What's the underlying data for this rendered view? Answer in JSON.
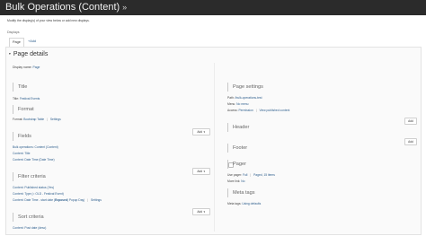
{
  "header": {
    "title": "Bulk Operations (Content)",
    "star": "»"
  },
  "description": "Modify the display(s) of your view below or add new displays.",
  "displays_label": "Displays",
  "tabs": [
    {
      "label": "Page"
    },
    {
      "label": "+Add"
    }
  ],
  "page_details": {
    "heading": "Page details",
    "caret": "▾",
    "display_name_label": "Display name:",
    "display_name_value": "Page"
  },
  "left": {
    "title": {
      "heading": "Title",
      "line_label": "Title:",
      "line_value": "Festival Events"
    },
    "format": {
      "heading": "Format",
      "label": "Format:",
      "value": "Bootstrap Table",
      "sep": "|",
      "settings": "Settings"
    },
    "fields": {
      "heading": "Fields",
      "add": "Add",
      "items": [
        "Bulk operations: Content (Content)",
        "Content: Title",
        "Content: Date Time (Date Time)"
      ]
    },
    "filter": {
      "heading": "Filter criteria",
      "add": "Add",
      "items": [
        "Content: Published status (Yes)",
        "Content: Type (= OLD - Festival Event)"
      ],
      "exposed_prefix": "Content: Date Time - start date (",
      "exposed_tag": "Exposed",
      "exposed_suffix": ") Popup Day)",
      "exposed_sep": "|",
      "exposed_settings": "Settings"
    },
    "sort": {
      "heading": "Sort criteria",
      "add": "Add",
      "items": [
        "Content: Post date (desc)"
      ]
    }
  },
  "right": {
    "page_settings": {
      "heading": "Page settings",
      "path_label": "Path:",
      "path_value": "/bulk-operations-test",
      "menu_label": "Menu:",
      "menu_value": "No menu",
      "access_label": "Access:",
      "access_value": "Permission",
      "access_sep": "|",
      "access_extra": "View published content"
    },
    "header": {
      "heading": "Header",
      "add": "Add"
    },
    "footer": {
      "heading": "Footer",
      "add": "Add"
    },
    "pager": {
      "heading": "Pager",
      "use_pager_label": "Use pager:",
      "use_pager_value": "Full",
      "use_pager_sep": "|",
      "use_pager_extra": "Paged, 15 items",
      "more_link_label": "More link:",
      "more_link_value": "No"
    },
    "meta_tags": {
      "heading": "Meta tags",
      "label": "Meta tags:",
      "value": "Using defaults"
    }
  },
  "colors": {
    "topbar": "#2b2b2b",
    "link": "#2c5d8c",
    "panel_bg": "#fafafa"
  },
  "icons": {
    "dropdown": "chevron-down-icon",
    "drag": "drag-handle-icon"
  }
}
